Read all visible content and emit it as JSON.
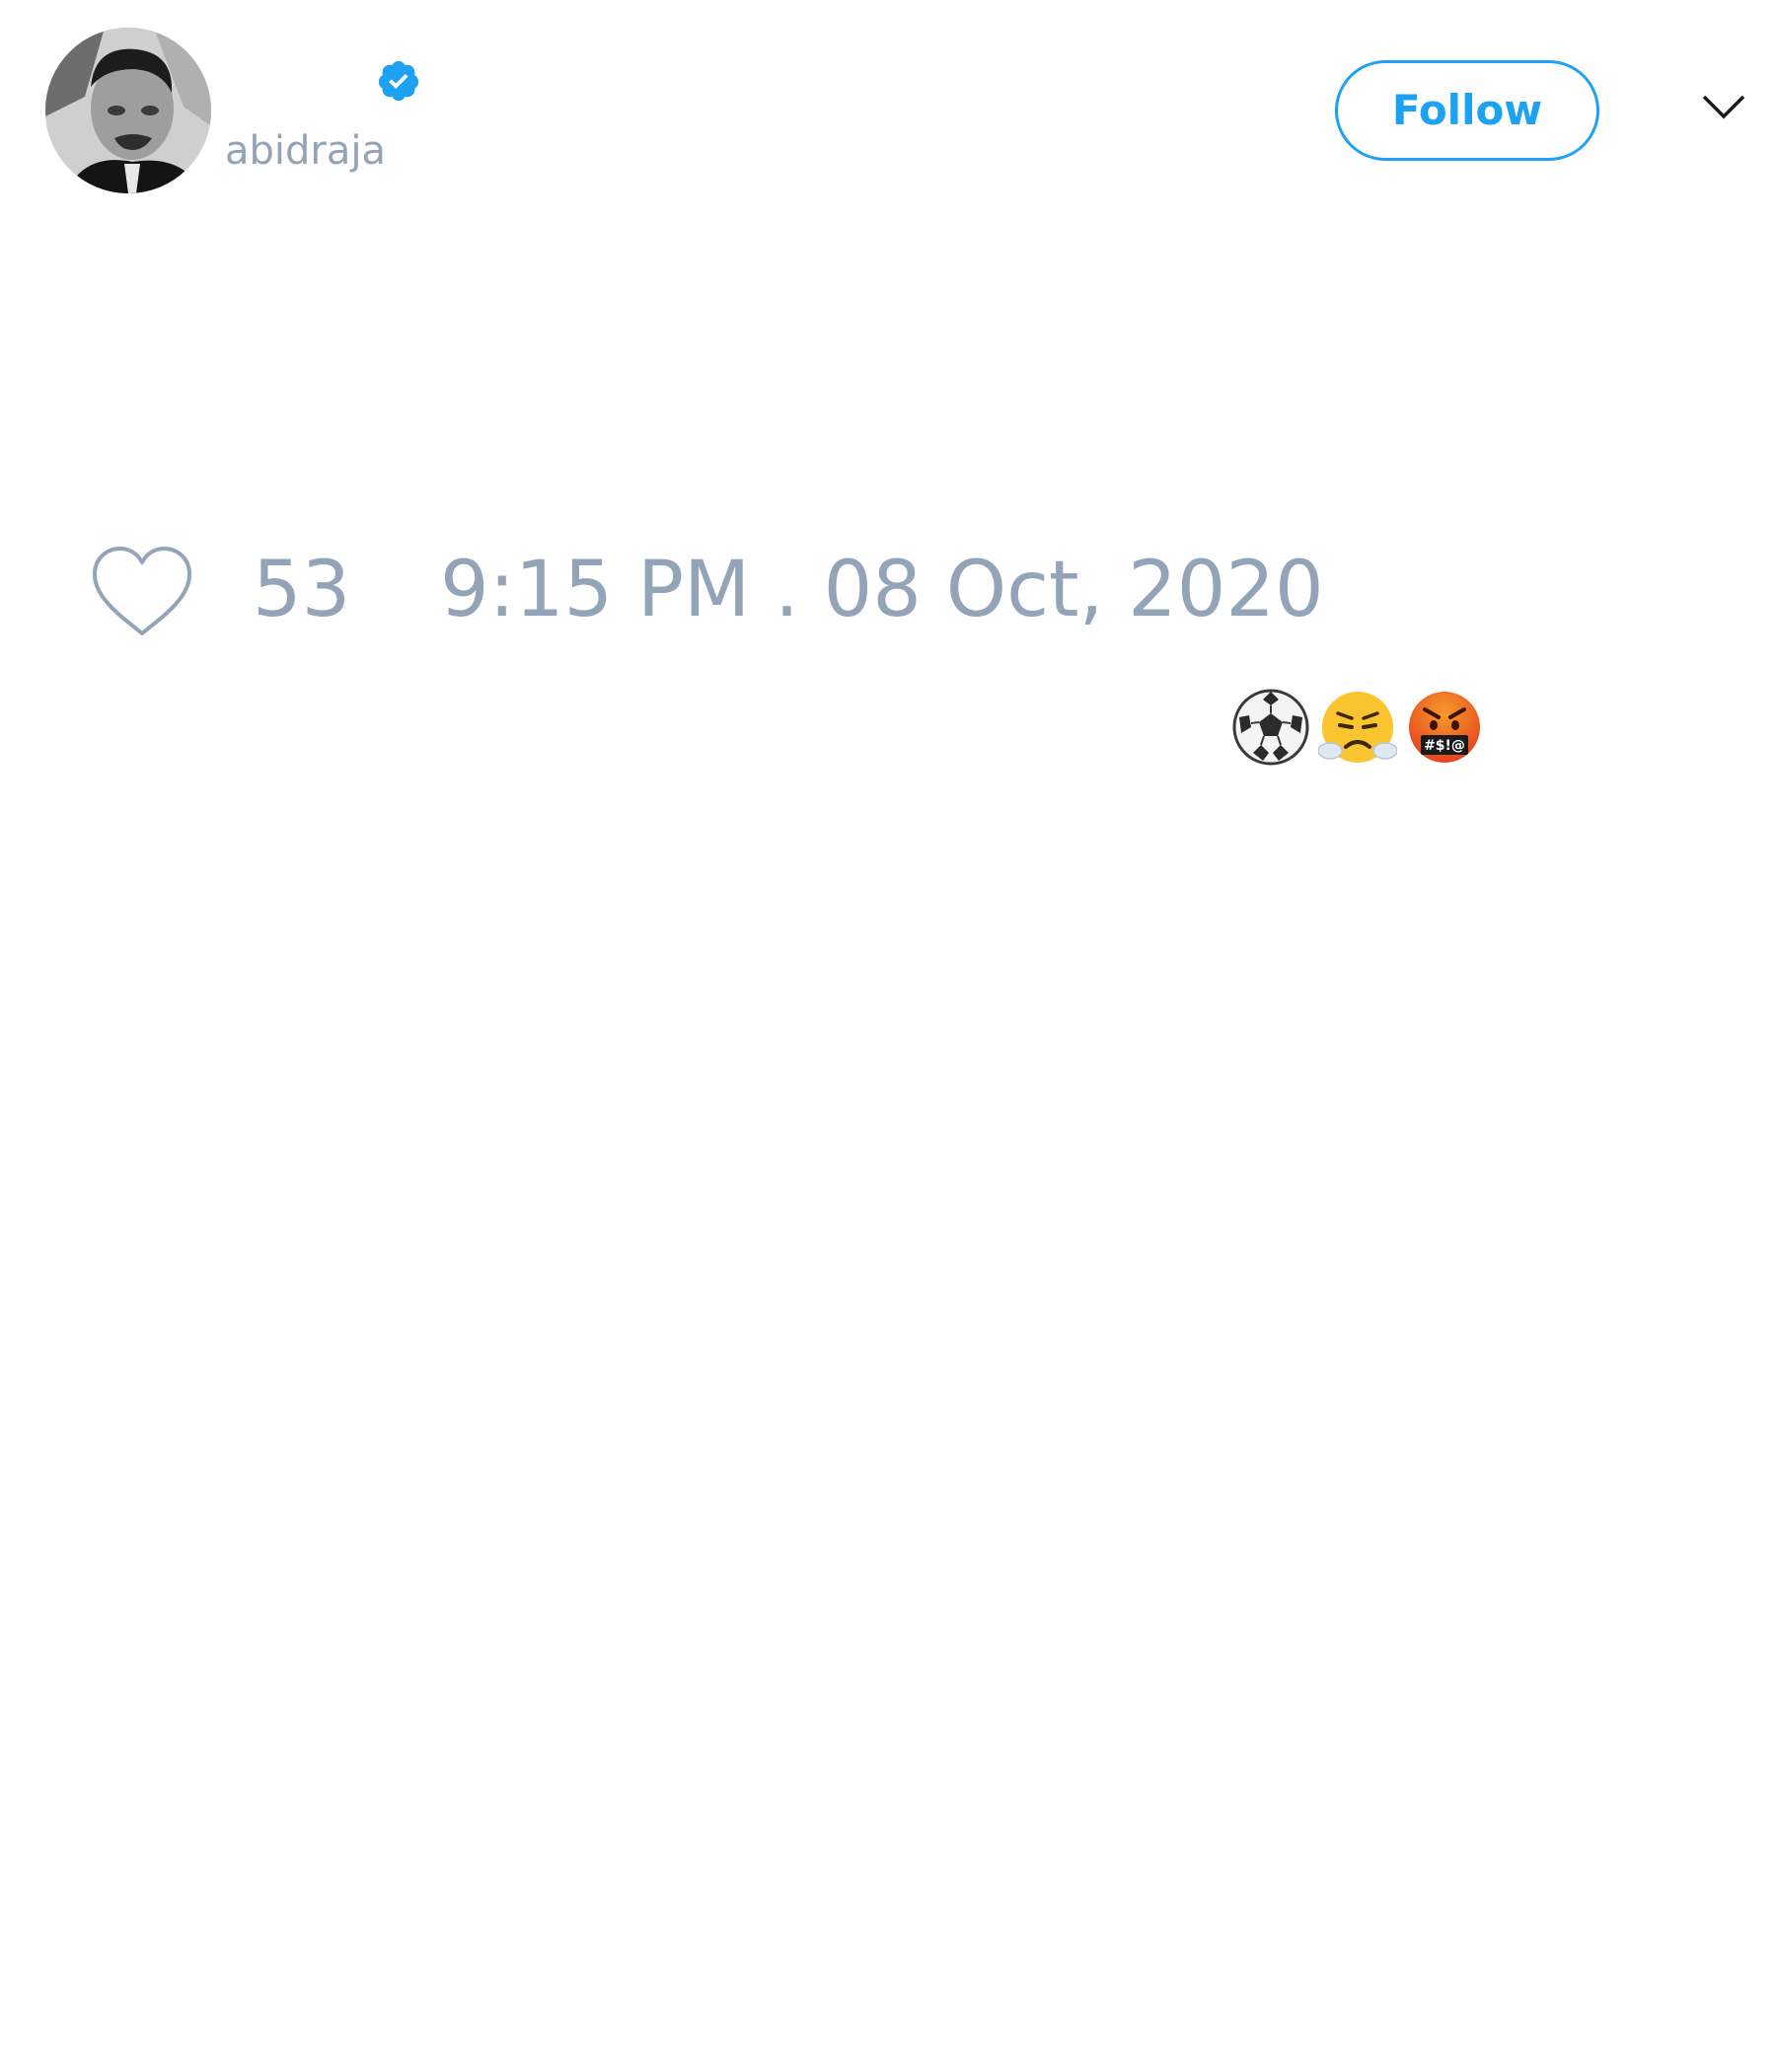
{
  "tweet": {
    "author": {
      "handle": "abidraja",
      "avatar_icon": "profile-photo",
      "verified": true,
      "verified_icon": "verified-badge-icon"
    },
    "follow_button": {
      "label": "Follow"
    },
    "menu_icon": "chevron-down-icon",
    "text_emojis": [
      "soccer-ball",
      "face-with-steam-from-nose",
      "face-with-symbols-on-mouth"
    ],
    "likes": {
      "icon": "heart-icon",
      "count": "53"
    },
    "timestamp": "9:15 PM . 08 Oct, 2020"
  },
  "colors": {
    "accent": "#1da1f2",
    "muted_text": "#93a3b8",
    "background": "#ffffff"
  }
}
